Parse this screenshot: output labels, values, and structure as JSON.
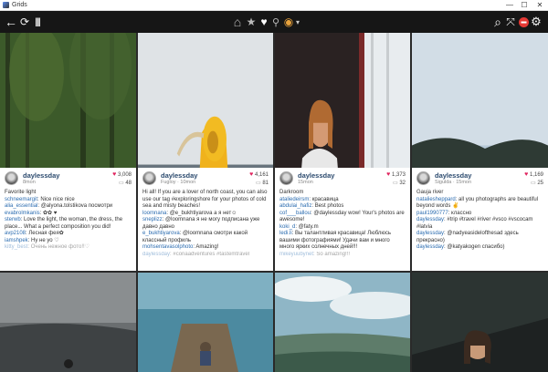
{
  "window": {
    "title": "Grids",
    "minimize": "—",
    "maximize": "☐",
    "close": "✕"
  },
  "toolbar": {
    "back": "←",
    "refresh": "⟳",
    "columns": "|||",
    "home": "⌂",
    "star": "★",
    "heart": "♥",
    "pin": "⚲",
    "account": "◉",
    "account_arrow": "▾",
    "search": "⌕",
    "shuffle": "⤧",
    "gear": "⚙"
  },
  "posts": [
    {
      "user": "daylessday",
      "time": "8mon",
      "likes": "3,008",
      "comments": "48",
      "caption": "Favorite light",
      "lines": [
        {
          "who": "schneemargit",
          "text": ": Nice nice nice"
        },
        {
          "who": "alia_essential",
          "text": ": @alyona.tolstikova посмотри"
        },
        {
          "who": "evabrolmkanis",
          "text": ": ✿✿ ♥"
        },
        {
          "who": "sterwb",
          "text": ": Love the light, the woman, the dress, the place... What a perfect composition you did!"
        },
        {
          "who": "avp2108",
          "text": ": Лесная фея✿"
        },
        {
          "who": "iamshpek",
          "text": ": Ну не уо ♡"
        },
        {
          "who": "kitty_best",
          "text": ": Очень нежное фото!!♡"
        }
      ]
    },
    {
      "user": "daylessday",
      "time": "Fugloy · 10mon",
      "likes": "4,161",
      "comments": "81",
      "caption": "Hi all! If you are a lover of north coast, you can also use our tag #exploringshore for your photos of cold sea and misty beaches!",
      "lines": [
        {
          "who": "loomnana",
          "text": ": @e_bukhtiyarova а я нет☺"
        },
        {
          "who": "sneplizz",
          "text": ": @loomnana я не могу подписана уже давно давно"
        },
        {
          "who": "e_bukhtiyarova",
          "text": ": @loomnana смотри какой классный профиль"
        },
        {
          "who": "mohsentavasolphoto",
          "text": ": Amazing!"
        },
        {
          "who": "daylessday",
          "text": ": #coriaadventures #tastemtravel"
        }
      ]
    },
    {
      "user": "daylessday",
      "time": "15mon",
      "likes": "1,373",
      "comments": "32",
      "caption": "Darkroom",
      "lines": [
        {
          "who": "ataliedeirsm",
          "text": ": красавица"
        },
        {
          "who": "abdulai_hafiz",
          "text": ": Best photos"
        },
        {
          "who": "cof___ballou",
          "text": ": @daylessday wow! Your's photos are awesome!"
        },
        {
          "who": "koki_d",
          "text": ": @faty.m"
        },
        {
          "who": "ledi.li",
          "text": ": Вы талантливая красавица! Люблюсь вашими фотографиями! Удачи вам и много много ярких солнечных дней!!!"
        },
        {
          "who": "mikeyuubynet",
          "text": ": So amazing!!!"
        }
      ]
    },
    {
      "user": "daylessday",
      "time": "Sigulda · 15mon",
      "likes": "1,169",
      "comments": "25",
      "caption": "Gauja river",
      "lines": [
        {
          "who": "nataliesheppard",
          "text": ": all you photographs are beautiful beyond words ✌"
        },
        {
          "who": "paul1990777",
          "text": ": классно"
        },
        {
          "who": "daylessday",
          "text": ": #trip #travel #river #vsco #vscocam #latvia"
        },
        {
          "who": "daylessday",
          "text": ": @nadyeasidelofthesad здесь прекрасно)"
        },
        {
          "who": "daylessday",
          "text": ": @katyakogen спасибо)"
        }
      ]
    }
  ]
}
